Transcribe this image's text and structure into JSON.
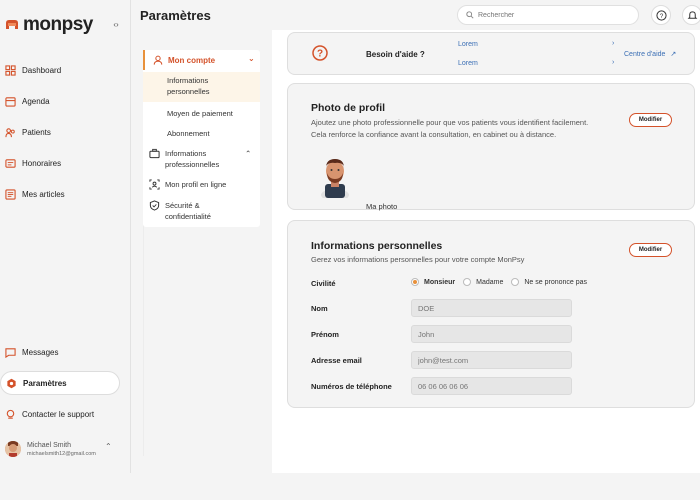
{
  "app": {
    "logo_text": "monpsy",
    "page_title": "Paramètres",
    "accent": "#d4522a",
    "accent_light": "#e8913b"
  },
  "sidebar": {
    "collapse_icon": "chevrons-left-right-icon",
    "items": [
      {
        "label": "Dashboard",
        "icon": "dashboard-icon"
      },
      {
        "label": "Agenda",
        "icon": "calendar-icon"
      },
      {
        "label": "Patients",
        "icon": "users-icon"
      },
      {
        "label": "Honoraires",
        "icon": "invoice-icon"
      },
      {
        "label": "Mes articles",
        "icon": "articles-icon"
      }
    ],
    "bottom_items": [
      {
        "label": "Messages",
        "icon": "message-icon"
      },
      {
        "label": "Paramètres",
        "icon": "settings-icon",
        "active": true
      },
      {
        "label": "Contacter le support",
        "icon": "support-icon"
      }
    ],
    "user": {
      "name": "Michael Smith",
      "email": "michaelsmith12@gmail.com"
    }
  },
  "header": {
    "search_placeholder": "Rechercher",
    "help_icon": "help-icon",
    "notifications_icon": "bell-icon"
  },
  "submenu": {
    "head": "Mon compte",
    "account_items": [
      "Informations personnelles",
      "Moyen de paiement",
      "Abonnement"
    ],
    "groups": [
      {
        "label": "Informations professionnelles",
        "icon": "briefcase-icon"
      },
      {
        "label": "Mon profil en ligne",
        "icon": "profile-scan-icon"
      },
      {
        "label": "Sécurité & confidentialité",
        "icon": "shield-icon"
      }
    ]
  },
  "help": {
    "title": "Besoin d'aide ?",
    "links": [
      "Lorem",
      "Lorem"
    ],
    "arrow": "›",
    "center": "Centre d'aide"
  },
  "photo": {
    "title": "Photo de profil",
    "desc1": "Ajoutez une photo professionnelle pour que vos patients vous identifient facilement.",
    "desc2": "Cela renforce la confiance avant la consultation, en cabinet ou à distance.",
    "modify": "Modifier",
    "label": "Ma photo"
  },
  "info": {
    "title": "Informations personnelles",
    "desc": "Gerez vos informations personnelles pour votre compte MonPsy",
    "modify": "Modifier",
    "civility_label": "Civilité",
    "civility_options": [
      "Monsieur",
      "Madame",
      "Ne se prononce pas"
    ],
    "civility_selected": "Monsieur",
    "fields": [
      {
        "label": "Nom",
        "value": "DOE"
      },
      {
        "label": "Prénom",
        "value": "John"
      },
      {
        "label": "Adresse email",
        "value": "john@test.com"
      },
      {
        "label": "Numéros de téléphone",
        "value": "06 06 06 06 06"
      }
    ]
  }
}
